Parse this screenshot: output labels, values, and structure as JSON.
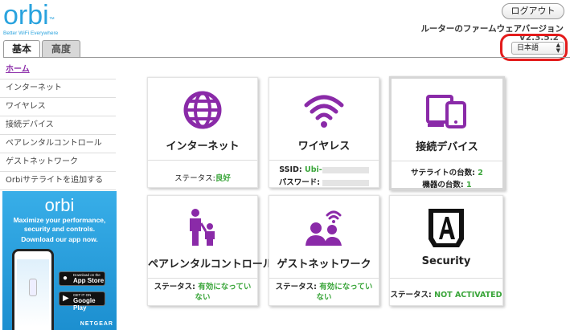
{
  "brand": {
    "name": "orbi",
    "tm": "™",
    "tagline": "Better WiFi Everywhere"
  },
  "header": {
    "logout_label": "ログアウト",
    "firmware_title": "ルーターのファームウェアバージョン",
    "firmware_version": "V2.3.5.2",
    "language": "日本語"
  },
  "tabs": [
    {
      "label": "基本"
    },
    {
      "label": "高度"
    }
  ],
  "nav": {
    "items": [
      {
        "label": "ホーム"
      },
      {
        "label": "インターネット"
      },
      {
        "label": "ワイヤレス"
      },
      {
        "label": "接続デバイス"
      },
      {
        "label": "ペアレンタルコントロール"
      },
      {
        "label": "ゲストネットワーク"
      },
      {
        "label": "Orbiサテライトを追加する"
      }
    ]
  },
  "ad": {
    "logo": "orbi",
    "headline": "Maximize your performance, security and controls.",
    "cta": "Download our app now.",
    "apple_small": "Download on the",
    "apple_big": "App Store",
    "google_small": "GET IT ON",
    "google_big": "Google Play",
    "brand": "NETGEAR"
  },
  "cards": {
    "internet": {
      "title": "インターネット",
      "status_label": "ステータス:",
      "status_value": "良好",
      "icon": "globe-icon"
    },
    "wireless": {
      "title": "ワイヤレス",
      "ssid_label": "SSID:",
      "ssid_value": "Ubi-",
      "password_label": "パスワード:",
      "icon": "wifi-icon"
    },
    "devices": {
      "title": "接続デバイス",
      "satellites_label": "サテライトの台数:",
      "satellites_value": "2",
      "devices_label": "機器の台数:",
      "devices_value": "1",
      "icon": "devices-icon"
    },
    "parental": {
      "title": "ペアレンタルコントロール",
      "status_label": "ステータス:",
      "status_value": "有効になっていない",
      "icon": "parent-child-icon"
    },
    "guest": {
      "title": "ゲストネットワーク",
      "status_label": "ステータス:",
      "status_value": "有効になっていない",
      "icon": "guest-wifi-icon"
    },
    "security": {
      "title": "Security",
      "status_label": "ステータス:",
      "status_value": "NOT ACTIVATED",
      "icon": "armor-a-icon"
    }
  },
  "colors": {
    "accent": "#8a2aa8",
    "status_good": "#3aa53a",
    "brand_blue": "#2aa3de",
    "highlight_ring": "#e31b1b"
  }
}
